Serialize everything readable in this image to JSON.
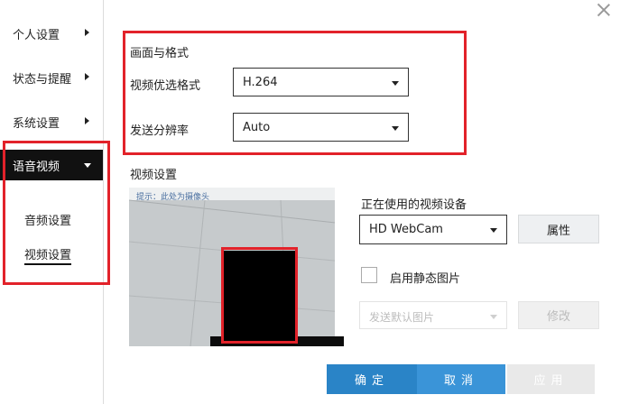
{
  "sidebar": {
    "items": [
      {
        "label": "个人设置"
      },
      {
        "label": "状态与提醒"
      },
      {
        "label": "系统设置"
      },
      {
        "label": "语音视频"
      }
    ],
    "sub_items": [
      {
        "label": "音频设置"
      },
      {
        "label": "视频设置"
      }
    ]
  },
  "format_section": {
    "title": "画面与格式",
    "format_label": "视频优选格式",
    "format_value": "H.264",
    "resolution_label": "发送分辨率",
    "resolution_value": "Auto"
  },
  "video_section": {
    "title": "视频设置",
    "device_label": "正在使用的视频设备",
    "device_value": "HD WebCam",
    "properties_button": "属性",
    "static_image_label": "启用静态图片",
    "default_image_value": "发送默认图片",
    "modify_button": "修改",
    "preview_overlay_text": "提示：此处为摄像头"
  },
  "footer": {
    "ok": "确定",
    "cancel": "取消",
    "apply": "应用"
  },
  "colors": {
    "annotation": "#e2222a",
    "primary": "#2a84c7",
    "active_nav": "#111111"
  },
  "icons": [
    "chevron-right-icon",
    "chevron-down-icon",
    "close-icon"
  ]
}
